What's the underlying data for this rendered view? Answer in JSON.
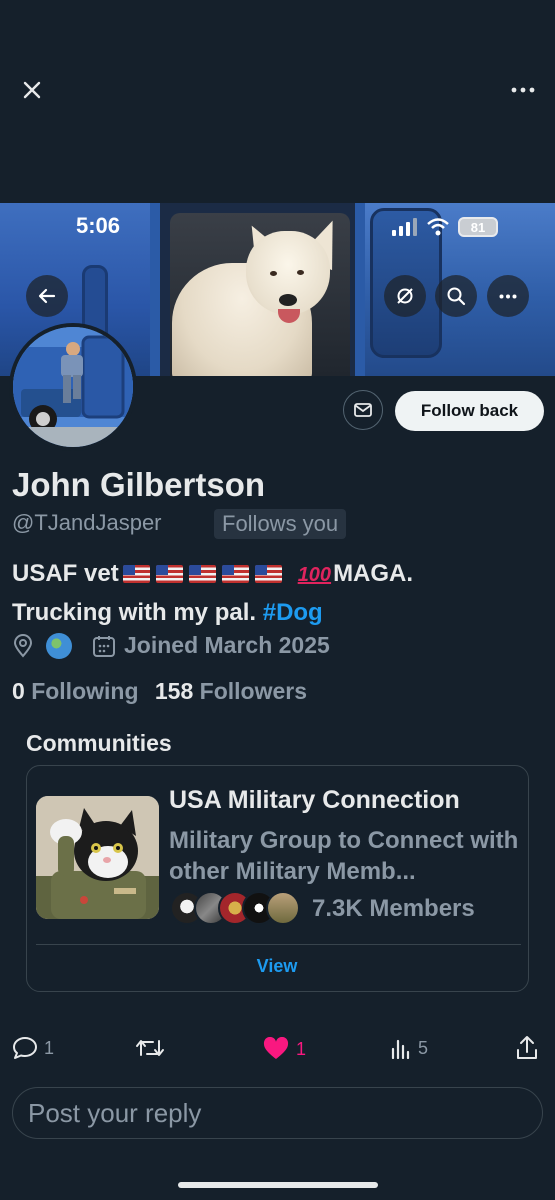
{
  "header": {
    "close_icon": "close-icon",
    "more_icon": "more-icon"
  },
  "banner": {
    "status_time": "5:06",
    "battery_level": "81",
    "back_icon": "back-arrow-icon",
    "actions": [
      "sync-off-icon",
      "search-icon",
      "more-icon"
    ]
  },
  "profile": {
    "name": "John Gilbertson",
    "handle": "@TJandJasper",
    "follows_you": "Follows you",
    "follow_back_label": "Follow back",
    "bio_line1_start": "USAF vet",
    "bio_hundred": "100",
    "bio_line1_end": "MAGA.",
    "bio_line2": "Trucking with my pal.",
    "bio_hashtag": "#Dog",
    "joined": "Joined March 2025",
    "following_count": "0",
    "following_label": "Following",
    "followers_count": "158",
    "followers_label": "Followers"
  },
  "communities": {
    "title": "Communities",
    "card": {
      "name": "USA Military Connection",
      "description": "Military Group to Connect with other Military Memb...",
      "members": "7.3K Members",
      "view_label": "View"
    }
  },
  "post_actions": {
    "reply_count": "1",
    "like_count": "1",
    "views_count": "5"
  },
  "reply": {
    "placeholder": "Post your reply"
  },
  "colors": {
    "background": "#15202b",
    "accent": "#1d9bf0",
    "like": "#f91880",
    "muted": "#8b98a5"
  }
}
